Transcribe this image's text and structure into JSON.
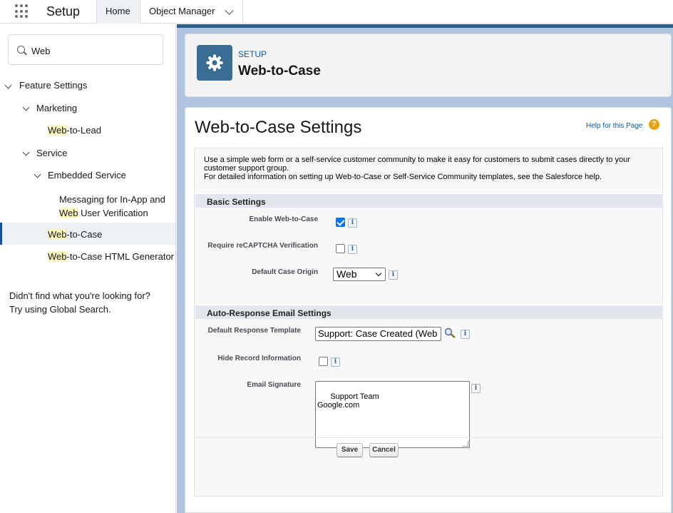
{
  "topbar": {
    "app_name": "Setup",
    "tabs": [
      {
        "label": "Home"
      },
      {
        "label": "Object Manager"
      }
    ]
  },
  "leftnav": {
    "search_value": "Web",
    "items": [
      {
        "label": "Feature Settings"
      },
      {
        "label": "Marketing"
      },
      {
        "label_hl": "Web",
        "label_rest": "-to-Lead"
      },
      {
        "label": "Service"
      },
      {
        "label": "Embedded Service"
      },
      {
        "label_line1": "Messaging for In-App and",
        "label_hl": "Web",
        "label_rest": " User Verification"
      },
      {
        "label_hl": "Web",
        "label_rest": "-to-Case"
      },
      {
        "label_hl": "Web",
        "label_rest": "-to-Case HTML Generator"
      }
    ],
    "not_found_line1": "Didn't find what you're looking for?",
    "not_found_line2": "Try using Global Search."
  },
  "header": {
    "eyebrow": "SETUP",
    "title": "Web-to-Case"
  },
  "main": {
    "title": "Web-to-Case Settings",
    "help_link": "Help for this Page",
    "intro_line1": "Use a simple web form or a self-service customer community to make it easy for customers to submit cases directly to your customer support group.",
    "intro_line2": "For detailed information on setting up Web-to-Case or Self-Service Community templates, see the Salesforce help.",
    "basic_section": "Basic Settings",
    "enable_label": "Enable Web-to-Case",
    "enable_checked": true,
    "recaptcha_label": "Require reCAPTCHA Verification",
    "recaptcha_checked": false,
    "origin_label": "Default Case Origin",
    "origin_value": "Web",
    "auto_section": "Auto-Response Email Settings",
    "template_label": "Default Response Template",
    "template_value": "Support: Case Created (Web",
    "hide_label": "Hide Record Information",
    "hide_checked": false,
    "signature_label": "Email Signature",
    "signature_value": "Support Team\nGoogle.com",
    "save_label": "Save",
    "cancel_label": "Cancel",
    "info_glyph": "i"
  },
  "colors": {
    "brand_blue": "#0b5cab",
    "setup_icon_bg": "#3a6d94",
    "selected_bar": "#1b5297",
    "highlight": "#fcf6c0",
    "help_icon": "#e8a213"
  }
}
